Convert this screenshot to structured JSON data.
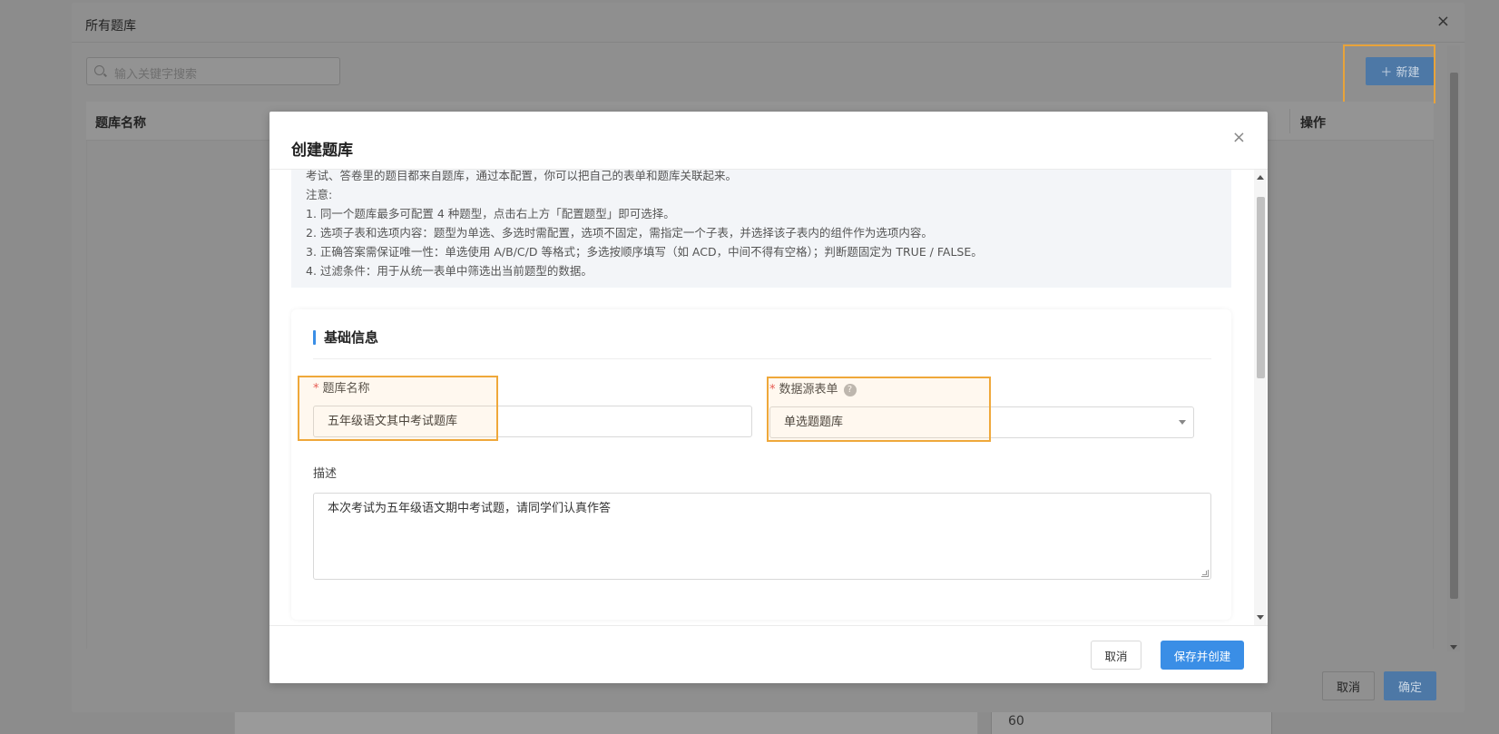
{
  "background": {
    "bottom_value": "60"
  },
  "outer_dialog": {
    "title": "所有题库",
    "close_glyph": "×",
    "search_placeholder": "输入关键字搜索",
    "new_button_label": "＋ 新建",
    "columns": [
      "题库名称",
      "操作"
    ],
    "cancel_label": "取消",
    "ok_label": "确定"
  },
  "inner_dialog": {
    "title": "创建题库",
    "close_glyph": "×",
    "notice_lines": [
      "考试、答卷里的题目都来自题库，通过本配置，你可以把自己的表单和题库关联起来。",
      "注意:",
      "1. 同一个题库最多可配置 4 种题型，点击右上方「配置题型」即可选择。",
      "2. 选项子表和选项内容：题型为单选、多选时需配置，选项不固定，需指定一个子表，并选择该子表内的组件作为选项内容。",
      "3. 正确答案需保证唯一性：单选使用 A/B/C/D 等格式；多选按顺序填写（如 ACD，中间不得有空格）；判断题固定为 TRUE / FALSE。",
      "4. 过滤条件：用于从统一表单中筛选出当前题型的数据。"
    ],
    "section_title": "基础信息",
    "fields": {
      "name_label": "题库名称",
      "name_value": "五年级语文其中考试题库",
      "source_label": "数据源表单",
      "source_value": "单选题题库",
      "help_glyph": "?",
      "required_mark": "*",
      "desc_label": "描述",
      "desc_value": "本次考试为五年级语文期中考试题，请同学们认真作答"
    },
    "cancel_label": "取消",
    "save_label": "保存并创建"
  },
  "colors": {
    "primary": "#3a8ee6",
    "highlight": "#efa83a",
    "required": "#e34d4d"
  }
}
